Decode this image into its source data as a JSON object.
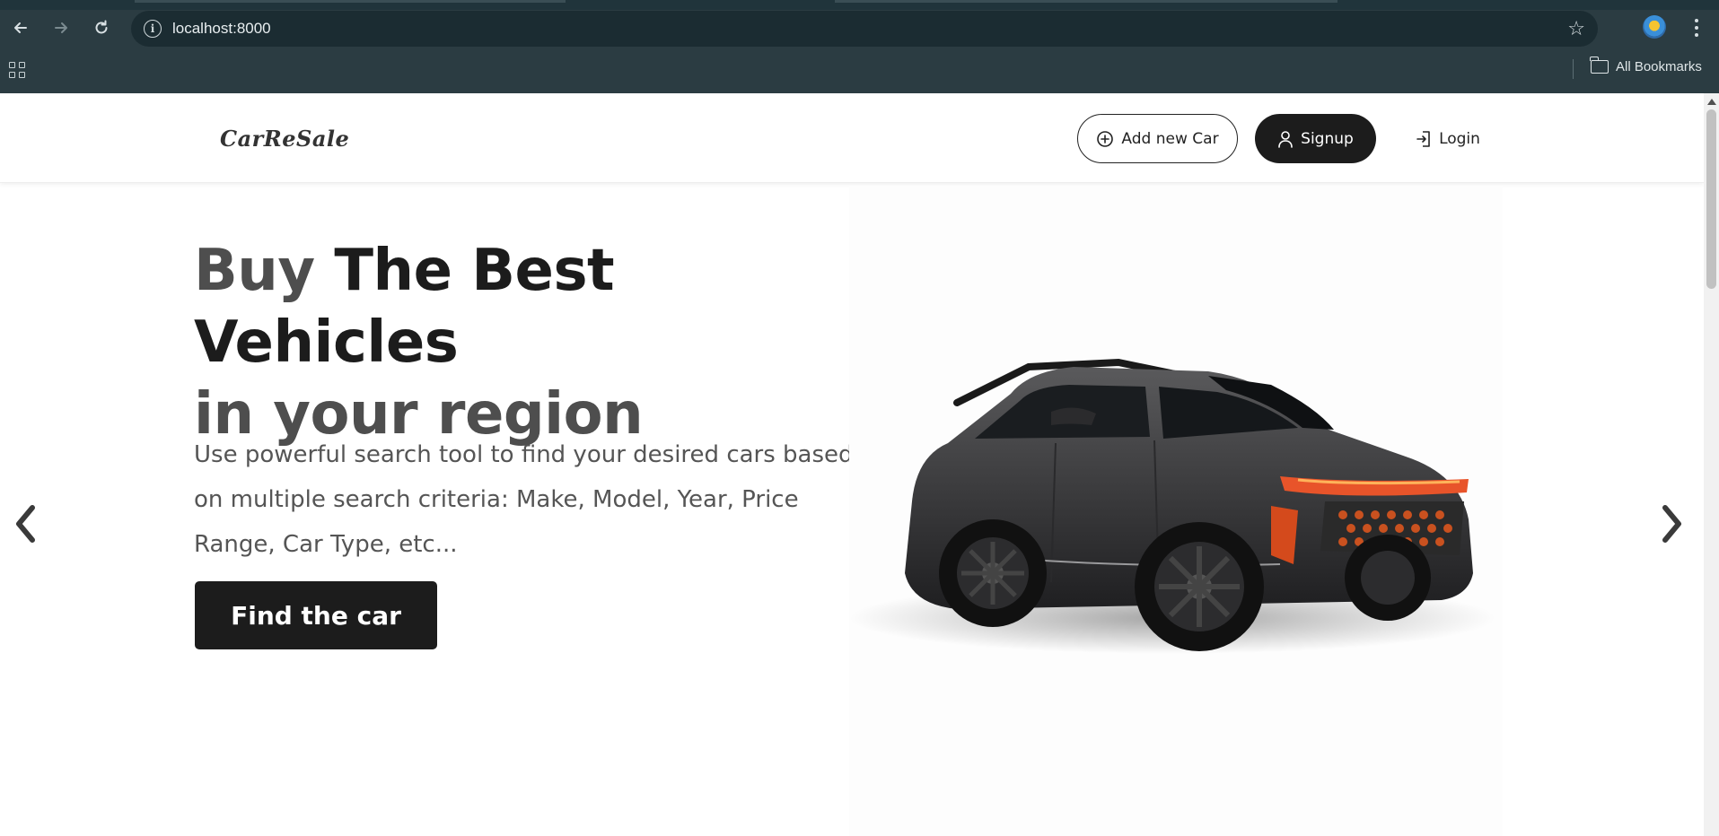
{
  "browser": {
    "url": "localhost:8000",
    "bookmarks_label": "All Bookmarks"
  },
  "header": {
    "logo": "CarReSale",
    "add_car_label": "Add new Car",
    "signup_label": "Signup",
    "login_label": "Login"
  },
  "hero": {
    "title_part1": "Buy",
    "title_part2": "The Best Vehicles",
    "title_part3": "in your region",
    "description": "Use powerful search tool to find your desired cars based on multiple search criteria: Make, Model, Year, Price Range, Car Type, etc...",
    "cta_label": "Find the car"
  },
  "colors": {
    "chrome_bg": "#2b3c42",
    "omnibox_bg": "#1b2c32",
    "primary_dark": "#1c1c1c",
    "text_grey": "#555555"
  }
}
